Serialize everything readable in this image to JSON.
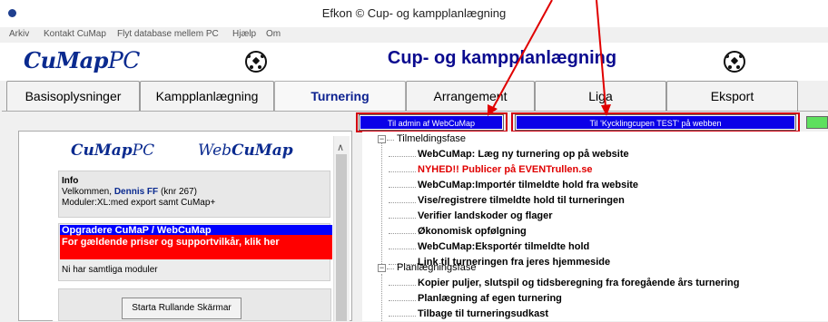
{
  "window": {
    "title": "Efkon © Cup- og kampplanlægning"
  },
  "menu": [
    "Arkiv",
    "Kontakt CuMap",
    "Flyt database mellem PC",
    "Hjælp",
    "Om"
  ],
  "header": {
    "logo": "CuMap",
    "logo_suffix": "PC",
    "title": "Cup- og kampplanlægning"
  },
  "tabs": [
    {
      "label": "Basisoplysninger",
      "active": false
    },
    {
      "label": "Kampplanlægning",
      "active": false
    },
    {
      "label": "Turnering",
      "active": true
    },
    {
      "label": "Arrangement",
      "active": false
    },
    {
      "label": "Liga",
      "active": false
    },
    {
      "label": "Eksport",
      "active": false
    }
  ],
  "web_buttons": {
    "admin": "Til admin af WebCuMap",
    "webpage": "Til 'Kycklingcupen TEST' på webben"
  },
  "web_panel": {
    "logo_left": "CuMap",
    "logo_left_suffix": "PC",
    "logo_right_prefix": "Web",
    "logo_right": "CuMap",
    "info_title": "Info",
    "welcome_prefix": "Velkommen,",
    "user_name": "Dennis FF",
    "user_knr": "(knr 267)",
    "modules_line": "Moduler:XL:med export samt CuMap+",
    "upgrade_title": "Opgradere CuMaP / WebCuMap",
    "upgrade_text": "For gældende priser og supportvilkår, klik her",
    "all_modules": "Ni har samtliga moduler",
    "start_button": "Starta Rullande Skärmar"
  },
  "tree": {
    "phase1": "Tilmeldingsfase",
    "phase1_items": [
      {
        "label": "WebCuMap: Læg ny turnering op på website",
        "color": "#000000"
      },
      {
        "label": "NYHED!! Publicer på EVENTrullen.se",
        "color": "#e00000"
      },
      {
        "label": "WebCuMap:Importér tilmeldte hold fra website",
        "color": "#000000"
      },
      {
        "label": "Vise/registrere tilmeldte hold til turneringen",
        "color": "#000000"
      },
      {
        "label": "Verifier landskoder og flager",
        "color": "#000000"
      },
      {
        "label": "Økonomisk opfølgning",
        "color": "#000000"
      },
      {
        "label": "WebCuMap:Eksportér tilmeldte hold",
        "color": "#000000"
      },
      {
        "label": "Link til turneringen fra jeres hjemmeside",
        "color": "#000000"
      }
    ],
    "phase2": "Planlægningsfase",
    "phase2_items": [
      {
        "label": "Kopier puljer, slutspil og tidsberegning fra foregående års turnering",
        "color": "#000000"
      },
      {
        "label": "Planlægning af egen turnering",
        "color": "#000000"
      },
      {
        "label": "Tilbage til turneringsudkast",
        "color": "#000000"
      }
    ]
  },
  "colors": {
    "accent_blue": "#0a00e8",
    "highlight_red": "#d20010",
    "logo_blue": "#0a2a8f"
  }
}
